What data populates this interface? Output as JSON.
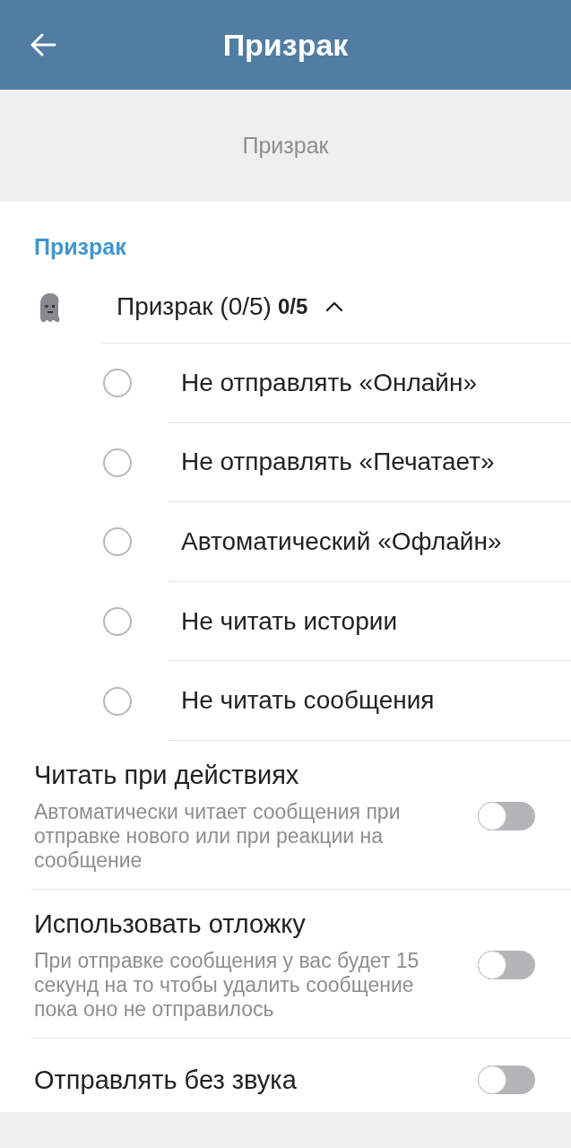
{
  "app_bar": {
    "title": "Призрак"
  },
  "info": {
    "text": "Призрак"
  },
  "section": {
    "header": "Призрак",
    "group": {
      "label": "Призрак (0/5)",
      "count": "0/5",
      "expanded": true,
      "options": [
        {
          "label": "Не отправлять «Онлайн»",
          "checked": false
        },
        {
          "label": "Не отправлять «Печатает»",
          "checked": false
        },
        {
          "label": "Автоматический «Офлайн»",
          "checked": false
        },
        {
          "label": "Не читать истории",
          "checked": false
        },
        {
          "label": "Не читать сообщения",
          "checked": false
        }
      ]
    }
  },
  "toggles": [
    {
      "title": "Читать при действиях",
      "description": "Автоматически читает сообщения при отправке нового или при реакции на сообщение",
      "on": false
    },
    {
      "title": "Использовать отложку",
      "description": "При отправке сообщения у вас будет 15 секунд на то чтобы удалить сообщение пока оно не отправилось",
      "on": false
    },
    {
      "title": "Отправлять без звука",
      "on": false
    }
  ]
}
